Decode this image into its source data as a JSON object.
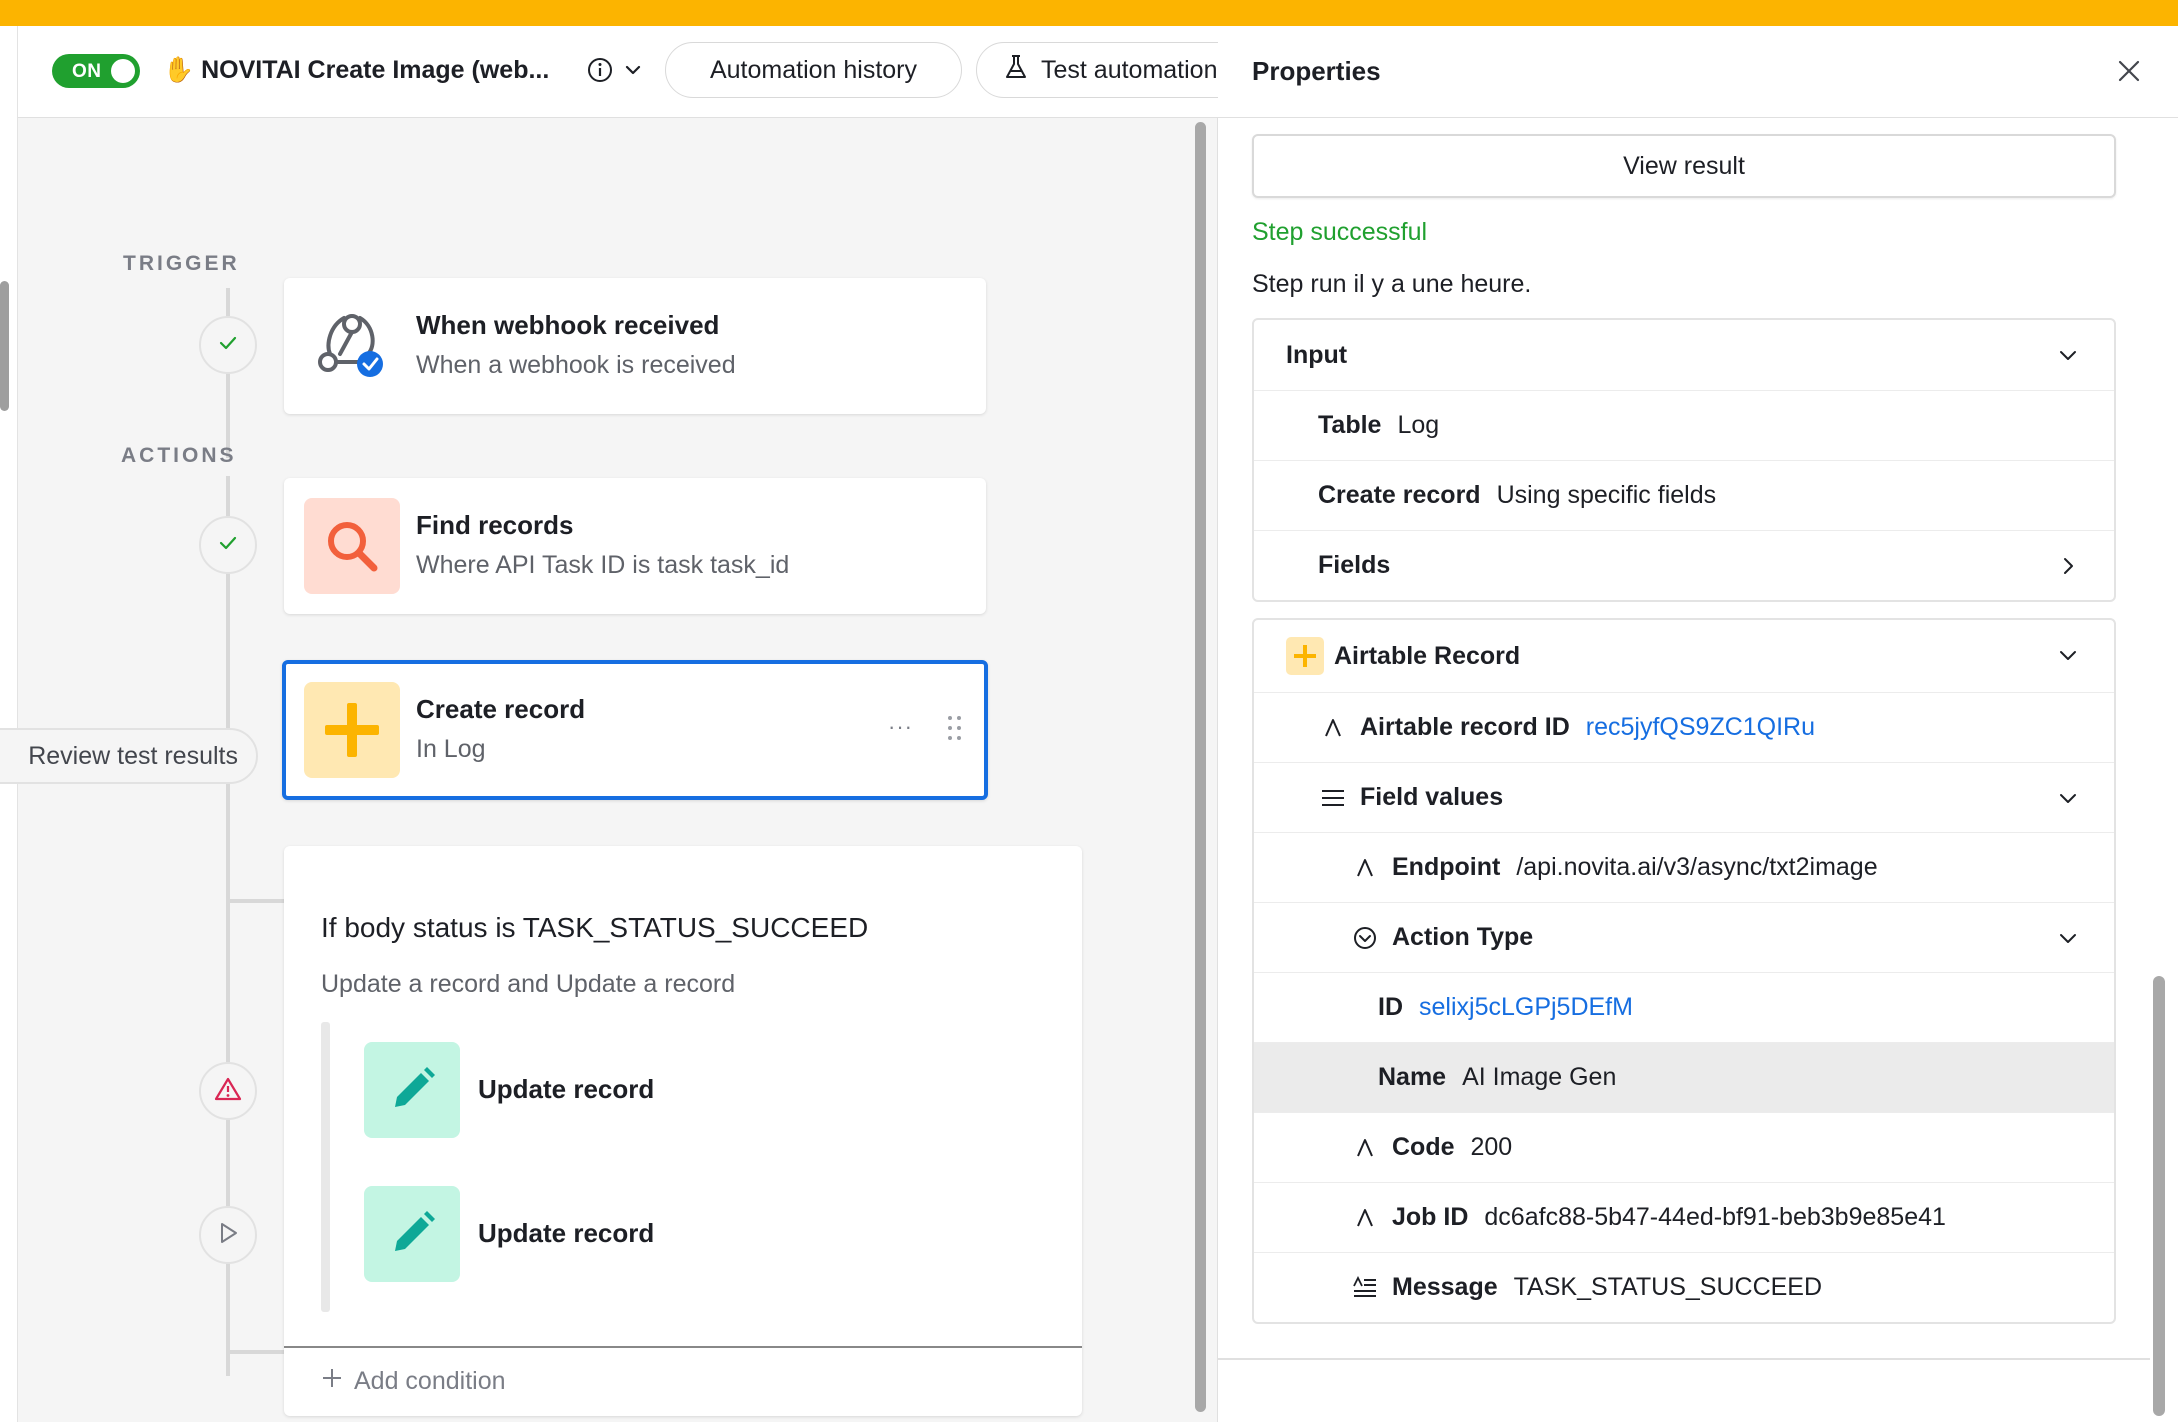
{
  "header": {
    "toggle_label": "ON",
    "automation_title": "✋ NOVITAI Create Image (web...",
    "automation_history": "Automation history",
    "test_automation": "Test automation"
  },
  "workflow": {
    "trigger_label": "TRIGGER",
    "actions_label": "ACTIONS",
    "review_test_results": "Review test results",
    "trigger_card": {
      "title": "When webhook received",
      "subtitle": "When a webhook is received"
    },
    "find_card": {
      "title": "Find records",
      "subtitle": "Where API Task ID is task task_id"
    },
    "create_card": {
      "title": "Create record",
      "subtitle": "In Log",
      "more": "···"
    },
    "condition": {
      "title": "If body status is TASK_STATUS_SUCCEED",
      "subtitle": "Update a record and Update a record",
      "items": [
        {
          "label": "Update record"
        },
        {
          "label": "Update record"
        }
      ],
      "add_condition": "Add condition"
    }
  },
  "properties": {
    "title": "Properties",
    "view_result": "View result",
    "step_status": "Step successful",
    "step_time": "Step run il y a une heure.",
    "input": {
      "header": "Input",
      "table_key": "Table",
      "table_value": "Log",
      "create_key": "Create record",
      "create_value": "Using specific fields",
      "fields_key": "Fields"
    },
    "record": {
      "header": "Airtable Record",
      "record_id_key": "Airtable record ID",
      "record_id_value": "rec5jyfQS9ZC1QIRu",
      "field_values_key": "Field values",
      "endpoint_key": "Endpoint",
      "endpoint_value": "/api.novita.ai/v3/async/txt2image",
      "action_type_key": "Action Type",
      "id_key": "ID",
      "id_value": "selixj5cLGPj5DEfM",
      "name_key": "Name",
      "name_value": "AI Image Gen",
      "code_key": "Code",
      "code_value": "200",
      "job_id_key": "Job ID",
      "job_id_value": "dc6afc88-5b47-44ed-bf91-beb3b9e85e41",
      "message_key": "Message",
      "message_value": "TASK_STATUS_SUCCEED"
    }
  },
  "colors": {
    "accent": "#fcb400",
    "primary": "#166ee1",
    "success": "#20a02f",
    "warning": "#d92654"
  }
}
